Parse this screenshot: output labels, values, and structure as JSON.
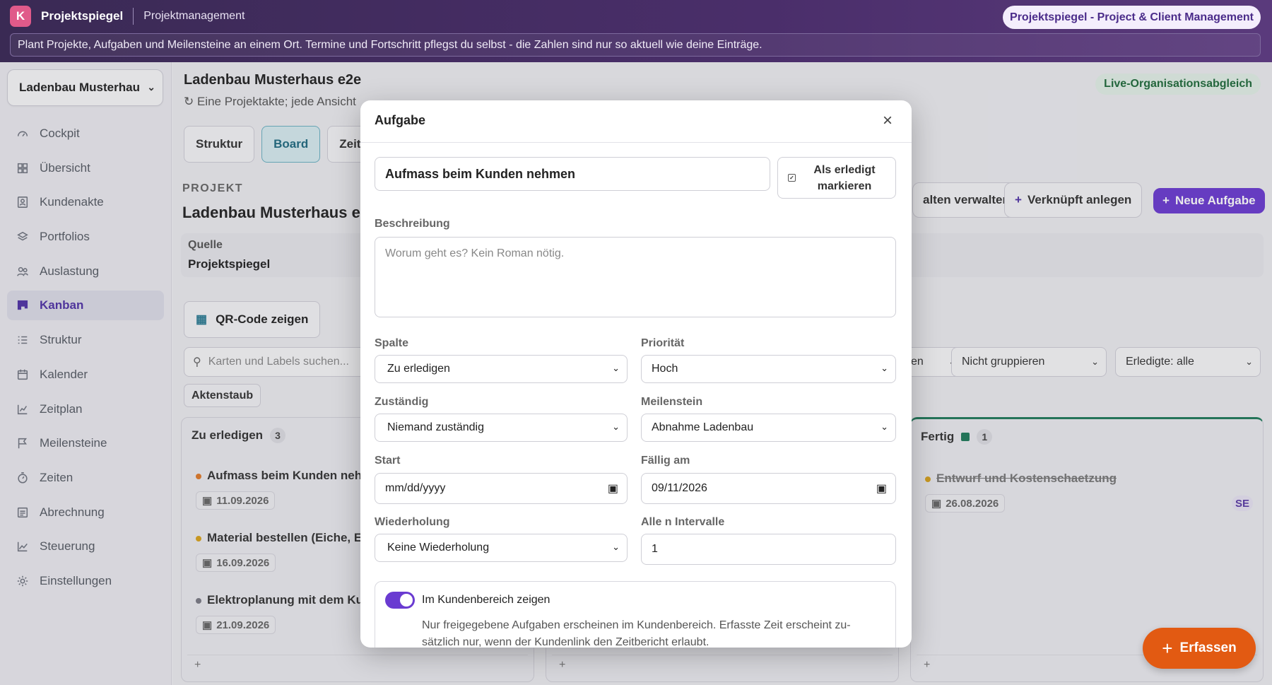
{
  "app": {
    "logo_letter": "K",
    "name": "Projektspiegel",
    "section": "Projektmanagement",
    "badge": "Projektspiegel - Project & Client Management",
    "notice": "Plant Projekte, Aufgaben und Meilensteine an einem Ort. Termine und Fortschritt pflegst du selbst - die Zahlen sind nur so aktuell wie deine Einträge."
  },
  "sidebar": {
    "project_select": "Ladenbau Musterhau",
    "items": [
      {
        "label": "Cockpit",
        "icon": "gauge-icon"
      },
      {
        "label": "Übersicht",
        "icon": "grid-icon"
      },
      {
        "label": "Kundenakte",
        "icon": "contact-icon"
      },
      {
        "label": "Portfolios",
        "icon": "layers-icon"
      },
      {
        "label": "Auslastung",
        "icon": "users-icon"
      },
      {
        "label": "Kanban",
        "icon": "kanban-icon"
      },
      {
        "label": "Struktur",
        "icon": "list-icon"
      },
      {
        "label": "Kalender",
        "icon": "calendar-icon"
      },
      {
        "label": "Zeitplan",
        "icon": "chart-line-icon"
      },
      {
        "label": "Meilensteine",
        "icon": "flag-icon"
      },
      {
        "label": "Zeiten",
        "icon": "stopwatch-icon"
      },
      {
        "label": "Abrechnung",
        "icon": "invoice-icon"
      },
      {
        "label": "Steuerung",
        "icon": "trend-icon"
      },
      {
        "label": "Einstellungen",
        "icon": "gear-icon"
      }
    ],
    "active_index": 5
  },
  "main": {
    "title": "Ladenbau Musterhaus e2e",
    "subtitle": "Eine Projektakte; jede Ansicht",
    "live_badge": "Live-Organisationsabgleich",
    "tabs": [
      "Struktur",
      "Board",
      "Zeit"
    ],
    "active_tab": 1,
    "section_label": "PROJEKT",
    "section_title": "Ladenbau Musterhaus e",
    "actions": {
      "manage": "alten verwalten",
      "linked": "Verknüpft anlegen",
      "new_task": "Neue Aufgabe"
    },
    "source_key": "Quelle",
    "source_value": "Projektspiegel",
    "qr_button": "QR-Code zeigen",
    "search_placeholder": "Karten und Labels suchen...",
    "filters": {
      "f1": "en",
      "f2": "Nicht gruppieren",
      "f3": "Erledigte: alle"
    },
    "chip": "Aktenstaub"
  },
  "board": {
    "columns": [
      {
        "title": "Zu erledigen",
        "count": "3",
        "cards": [
          {
            "title": "Aufmass beim Kunden neh",
            "date": "11.09.2026",
            "dot": "#e07a2a"
          },
          {
            "title": "Material bestellen (Eiche, E",
            "date": "16.09.2026",
            "dot": "#d9a21c"
          },
          {
            "title": "Elektroplanung mit dem Ku",
            "date": "21.09.2026",
            "dot": "#7a7a84"
          }
        ],
        "add": "+"
      },
      {
        "title": "",
        "count": "",
        "cards": [],
        "add": "+"
      },
      {
        "title": "Fertig",
        "count": "1",
        "cards": [
          {
            "title": "Entwurf und Kostenschaetzung",
            "date": "26.08.2026",
            "dot": "#d9a21c",
            "avatar": "SE"
          }
        ],
        "add": "+"
      }
    ]
  },
  "modal": {
    "title": "Aufgabe",
    "task_title": "Aufmass beim Kunden nehmen",
    "done_button": "Als erledigt markieren",
    "description_label": "Beschreibung",
    "description_placeholder": "Worum geht es? Kein Roman nötig.",
    "column_label": "Spalte",
    "column_value": "Zu erledigen",
    "priority_label": "Priorität",
    "priority_value": "Hoch",
    "assignee_label": "Zuständig",
    "assignee_value": "Niemand zuständig",
    "milestone_label": "Meilenstein",
    "milestone_value": "Abnahme Ladenbau",
    "start_label": "Start",
    "start_value": "mm/dd/yyyy",
    "due_label": "Fällig am",
    "due_value": "09/11/2026",
    "repeat_label": "Wiederholung",
    "repeat_value": "Keine Wiederholung",
    "interval_label": "Alle n Intervalle",
    "interval_value": "1",
    "client_toggle_label": "Im Kundenbereich zeigen",
    "client_toggle_desc": "Nur freigegebene Aufgaben erscheinen im Kundenbereich. Erfasste Zeit erscheint zu-sätzlich nur, wenn der Kundenlink den Zeitbericht erlaubt."
  },
  "fab": {
    "label": "Erfassen"
  },
  "colors": {
    "accent": "#6a3bd1",
    "fab": "#e25a12",
    "fertig_border": "#1f7a5a"
  }
}
